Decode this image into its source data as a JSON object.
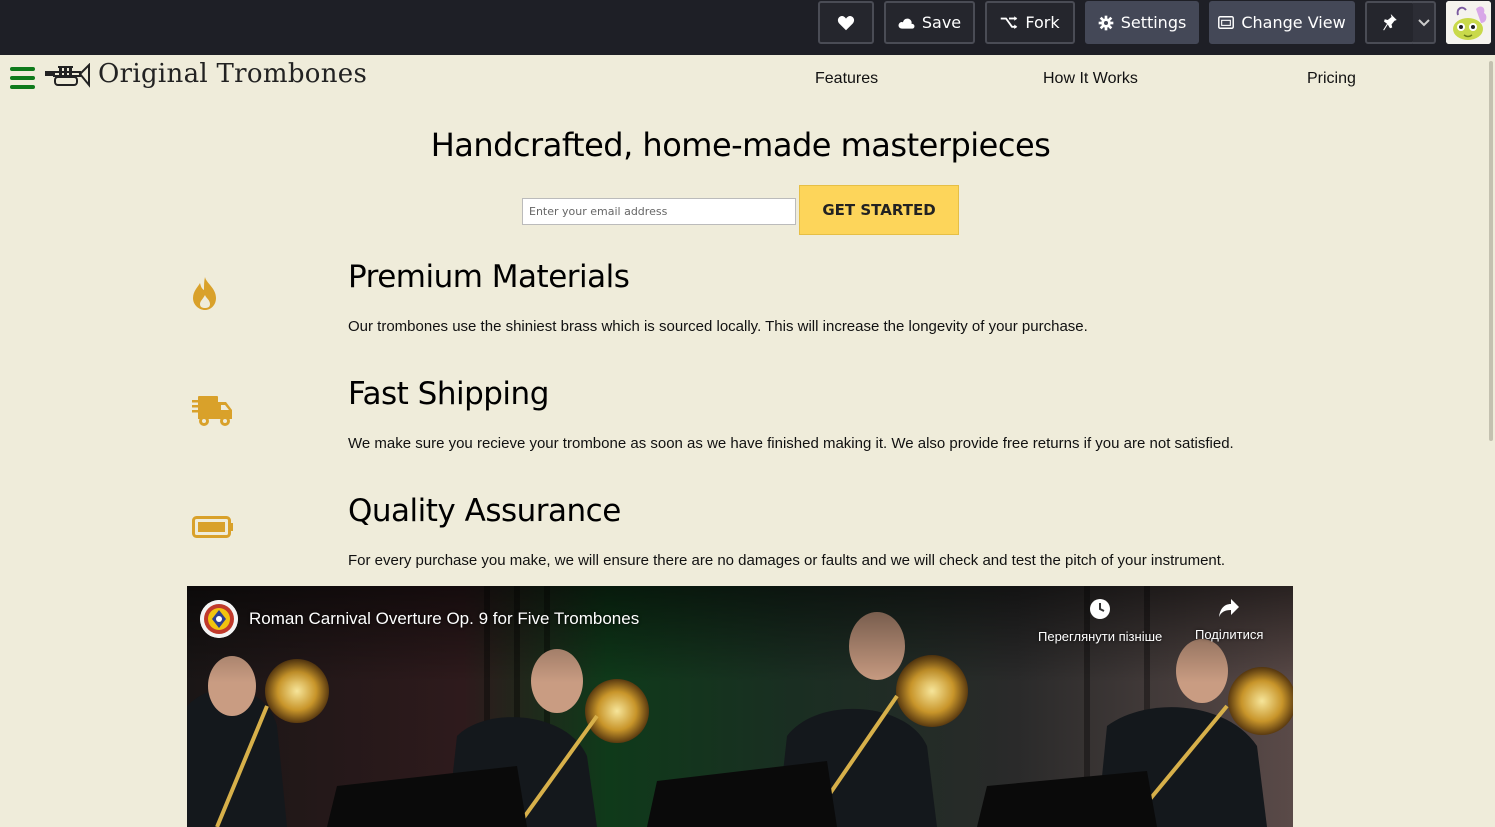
{
  "topbar": {
    "like_icon": "heart-icon",
    "save_label": "Save",
    "fork_label": "Fork",
    "settings_label": "Settings",
    "change_view_label": "Change View",
    "pin_icon": "pin-icon",
    "dropdown_icon": "chevron-down-icon"
  },
  "header": {
    "logo_text": "Original Trombones",
    "nav": [
      {
        "label": "Features"
      },
      {
        "label": "How It Works"
      },
      {
        "label": "Pricing"
      }
    ]
  },
  "hero": {
    "title": "Handcrafted, home-made masterpieces",
    "email_placeholder": "Enter your email address",
    "cta_label": "GET STARTED"
  },
  "features": [
    {
      "icon": "fire-icon",
      "title": "Premium Materials",
      "description": "Our trombones use the shiniest brass which is sourced locally. This will increase the longevity of your purchase."
    },
    {
      "icon": "truck-icon",
      "title": "Fast Shipping",
      "description": "We make sure you recieve your trombone as soon as we have finished making it. We also provide free returns if you are not satisfied."
    },
    {
      "icon": "battery-icon",
      "title": "Quality Assurance",
      "description": "For every purchase you make, we will ensure there are no damages or faults and we will check and test the pitch of your instrument."
    }
  ],
  "video": {
    "title": "Roman Carnival Overture Op. 9 for Five Trombones",
    "watch_later_label": "Переглянути пізніше",
    "share_label": "Поділитися"
  },
  "colors": {
    "accent": "#fdd55a",
    "icon_gold": "#d9a12a",
    "page_bg": "#efecda",
    "topbar_bg": "#1e1f26",
    "hamburger_green": "#0e7a1b"
  }
}
